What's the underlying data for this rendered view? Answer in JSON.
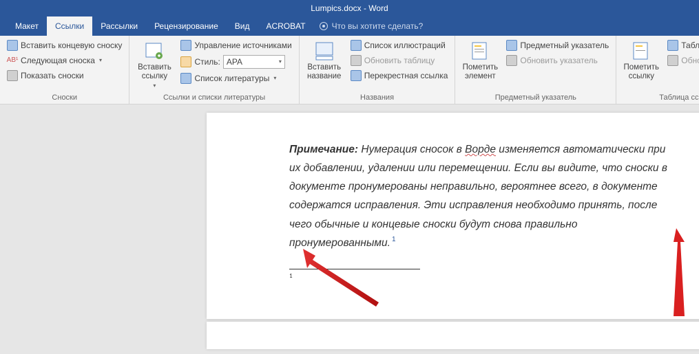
{
  "title": "Lumpics.docx - Word",
  "tabs": {
    "maket": "Макет",
    "links": "Ссылки",
    "mailings": "Рассылки",
    "review": "Рецензирование",
    "view": "Вид",
    "acrobat": "ACROBAT",
    "tellme": "Что вы хотите сделать?"
  },
  "ribbon": {
    "footnotes": {
      "insert_endnote": "Вставить концевую сноску",
      "next_footnote": "Следующая сноска",
      "show_notes": "Показать сноски",
      "label": "Сноски"
    },
    "citations": {
      "insert_citation": "Вставить ссылку",
      "manage_sources": "Управление источниками",
      "style_label": "Стиль:",
      "style_value": "APA",
      "bibliography": "Список литературы",
      "label": "Ссылки и списки литературы"
    },
    "captions": {
      "insert_caption": "Вставить название",
      "table_of_figures": "Список иллюстраций",
      "update_table": "Обновить таблицу",
      "cross_reference": "Перекрестная ссылка",
      "label": "Названия"
    },
    "index": {
      "mark_entry": "Пометить элемент",
      "insert_index": "Предметный указатель",
      "update_index": "Обновить указатель",
      "label": "Предметный указатель"
    },
    "toa": {
      "mark_citation": "Пометить ссылку",
      "insert_toa": "Таблица ссылок",
      "update_toa": "Обновить таблицу",
      "label": "Таблица ссылок"
    }
  },
  "document": {
    "note_label": "Примечание:",
    "body": " Нумерация сносок в Ворде изменяется автоматически при их добавлении, удалении или перемещении. Если вы видите, что сноски в документе пронумерованы неправильно, вероятнее всего, в документе содержатся исправления. Эти исправления необходимо принять, после чего обычные и концевые сноски будут снова правильно пронумерованными.",
    "fn_ref": "1",
    "fn_num": "1"
  }
}
